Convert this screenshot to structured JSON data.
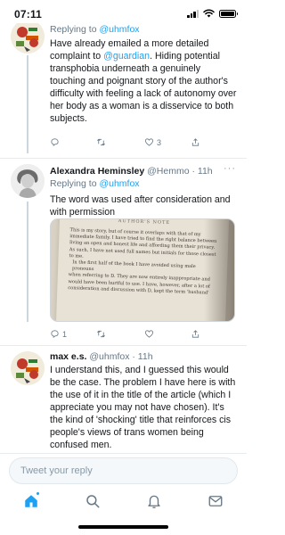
{
  "status_bar": {
    "time": "07:11",
    "icons": [
      "signal-icon",
      "wifi-icon",
      "battery-icon"
    ]
  },
  "tweets": [
    {
      "id": "tweet-1",
      "replying_prefix": "Replying to ",
      "replying_handle": "@uhmfox",
      "text_parts": [
        "Have already emailed a more detailed complaint to ",
        "@guardian",
        ". Hiding potential transphobia underneath a genuinely touching and poignant story of the author's difficulty with feeling a lack of autonomy over her body as a woman is a disservice to both subjects."
      ],
      "counts": {
        "reply": "",
        "retweet": "",
        "like": "3",
        "share": ""
      }
    },
    {
      "id": "tweet-2",
      "name": "Alexandra Heminsley",
      "handle": "@Hemmo",
      "time": "· 11h",
      "replying_prefix": "Replying to ",
      "replying_handle": "@uhmfox",
      "text": "The word was used after consideration and with permission",
      "media": {
        "header": "AUTHOR'S NOTE",
        "lines": [
          "This is my story, but of course it overlaps with that of my",
          "immediate family. I have tried to find the right balance between",
          "living an open and honest life and affording them their privacy.",
          "As such, I have not used full names but initials for those closest",
          "to me.",
          "In the first half of the book I have avoided using male pronouns",
          "when referring to D. They are now entirely inappropriate and",
          "would have been hurtful to use. I have, however, after a lot of",
          "consideration and discussion with D, kept the term 'husband'"
        ]
      },
      "counts": {
        "reply": "1",
        "retweet": "",
        "like": "",
        "share": ""
      }
    },
    {
      "id": "tweet-3",
      "name": "max e.s.",
      "handle": "@uhmfox",
      "time": "· 11h",
      "text": "I understand this, and I guessed this would be the case. The problem I have here is with the use of it in the title of the article (which I appreciate you may not have chosen). It's the kind of 'shocking' title that reinforces cis people's views of trans women being confused men."
    }
  ],
  "composer": {
    "placeholder": "Tweet your reply"
  },
  "tabbar": {
    "items": [
      "home-icon",
      "search-icon",
      "notifications-icon",
      "messages-icon"
    ],
    "accent": "#1da1f2"
  },
  "colors": {
    "accent": "#1da1f2",
    "text": "#14171a",
    "muted": "#657786",
    "divider": "#e6ecf0"
  }
}
